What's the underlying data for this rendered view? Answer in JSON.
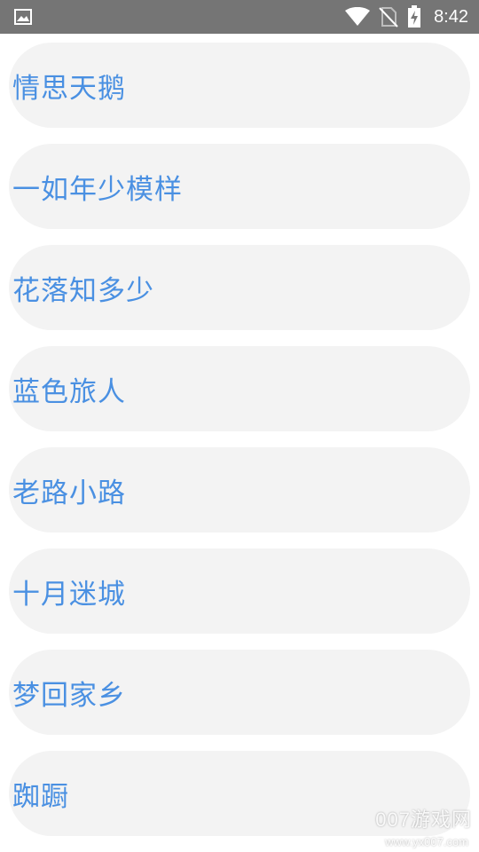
{
  "status_bar": {
    "time": "8:42",
    "icons": {
      "left": "image-icon",
      "wifi": "wifi-icon",
      "signal": "no-sim-icon",
      "battery": "battery-charging-icon"
    },
    "background": "#757575"
  },
  "list": {
    "items": [
      {
        "label": "情思天鹅"
      },
      {
        "label": "一如年少模样"
      },
      {
        "label": "花落知多少"
      },
      {
        "label": "蓝色旅人"
      },
      {
        "label": "老路小路"
      },
      {
        "label": "十月迷城"
      },
      {
        "label": "梦回家乡"
      },
      {
        "label": "踟蹰"
      }
    ],
    "item_background": "#f3f3f3",
    "label_color": "#4a90e2"
  },
  "watermark": {
    "title": "007游戏网",
    "url": "www.yx007.com"
  }
}
